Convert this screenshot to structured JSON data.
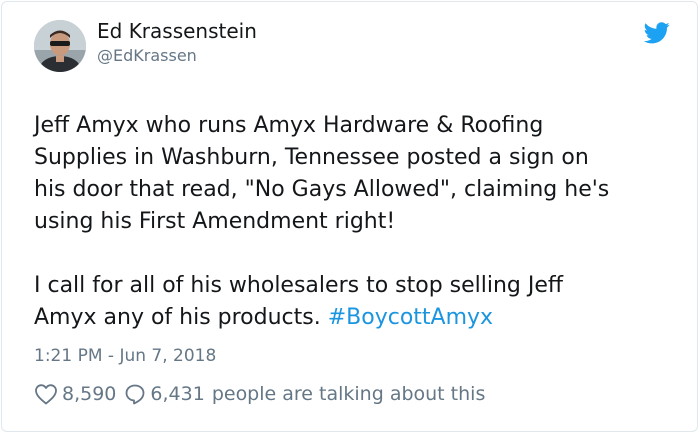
{
  "tweet": {
    "author_name": "Ed Krassenstein",
    "author_handle": "@EdKrassen",
    "avatar_icon": "user-avatar",
    "brand_icon": "twitter-bird-icon",
    "brand_color": "#1da1f2",
    "lines_para1": [
      "Jeff Amyx who runs Amyx Hardware & Roofing",
      "Supplies in Washburn, Tennessee posted a sign on",
      "his door that read, \"No Gays Allowed\", claiming he's",
      "using his First Amendment right!"
    ],
    "para2_line1": "I call for all of his wholesalers to stop selling Jeff",
    "para2_line2_text": "Amyx any of his products.",
    "hashtag": "#BoycottAmyx",
    "hashtag_color": "#1b95e0",
    "timestamp": "1:21 PM - Jun 7, 2018",
    "likes": "8,590",
    "replies": "6,431",
    "talking_text": "people are talking about this"
  }
}
